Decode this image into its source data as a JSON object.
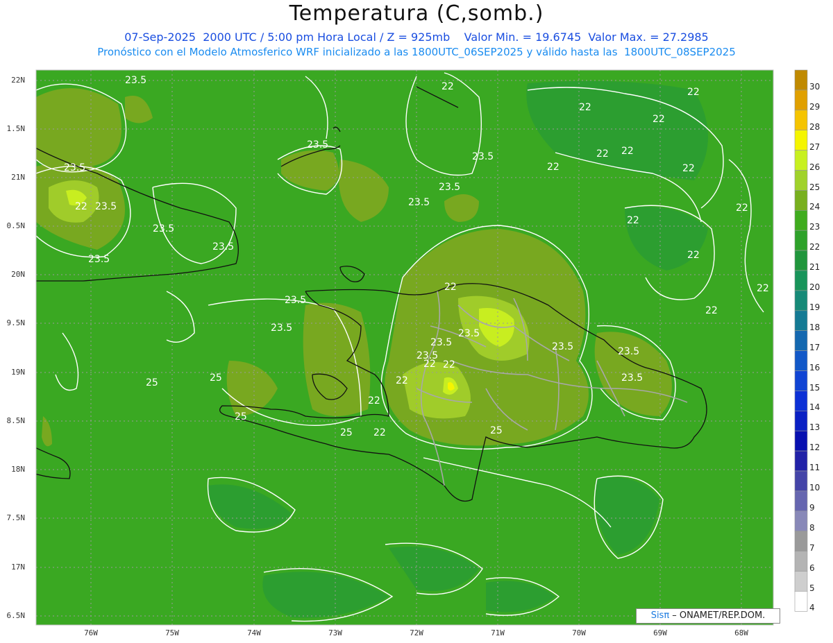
{
  "header": {
    "title": "Temperatura (C,somb.)",
    "line1": "07-Sep-2025  2000 UTC / 5:00 pm Hora Local / Z = 925mb    Valor Min. = 19.6745  Valor Max. = 27.2985",
    "line2": "Pronóstico con el Modelo Atmosferico WRF inicializado a las 1800UTC_06SEP2025 y válido hasta las  1800UTC_08SEP2025"
  },
  "axes": {
    "lat_labels": [
      "22N",
      "1.5N",
      "21N",
      "0.5N",
      "20N",
      "9.5N",
      "19N",
      "8.5N",
      "18N",
      "7.5N",
      "17N",
      "6.5N"
    ],
    "lon_labels": [
      "76W",
      "75W",
      "74W",
      "73W",
      "72W",
      "71W",
      "70W",
      "69W",
      "68W"
    ]
  },
  "contour_labels": [
    "23.5",
    "23.5",
    "23.5",
    "23.5",
    "23.5",
    "23.5",
    "23.5",
    "23.5",
    "23.5",
    "23.5",
    "23.5",
    "23.5",
    "23.5",
    "23.5",
    "23.5",
    "23.5",
    "23.5",
    "23.5",
    "25",
    "25",
    "25",
    "25",
    "25",
    "22",
    "22",
    "22",
    "22",
    "22",
    "22",
    "22",
    "22",
    "22",
    "22",
    "22",
    "22",
    "22",
    "22",
    "22",
    "22",
    "22",
    "22",
    "22",
    "22"
  ],
  "colorbar": {
    "labels": [
      "30",
      "29",
      "28",
      "27",
      "26",
      "25",
      "24",
      "23",
      "22",
      "21",
      "20",
      "19",
      "18",
      "17",
      "16",
      "15",
      "14",
      "13",
      "12",
      "11",
      "10",
      "9",
      "8",
      "7",
      "6",
      "5",
      "4"
    ],
    "colors": [
      "#c08a00",
      "#e0a000",
      "#f5c400",
      "#f5f500",
      "#c8f020",
      "#a0d22a",
      "#78b01e",
      "#3fac1e",
      "#2ea22a",
      "#20963c",
      "#18945a",
      "#168a78",
      "#147a94",
      "#1468b0",
      "#1258c8",
      "#1044d4",
      "#0c30d6",
      "#0a20c4",
      "#0810b0",
      "#2222a8",
      "#4444a8",
      "#6666b0",
      "#8888b8",
      "#9a9a9a",
      "#b4b4b4",
      "#cecece",
      "#ffffff"
    ]
  },
  "credit": {
    "brand": "Sisπ",
    "text": " – ONAMET/REP.DOM."
  }
}
